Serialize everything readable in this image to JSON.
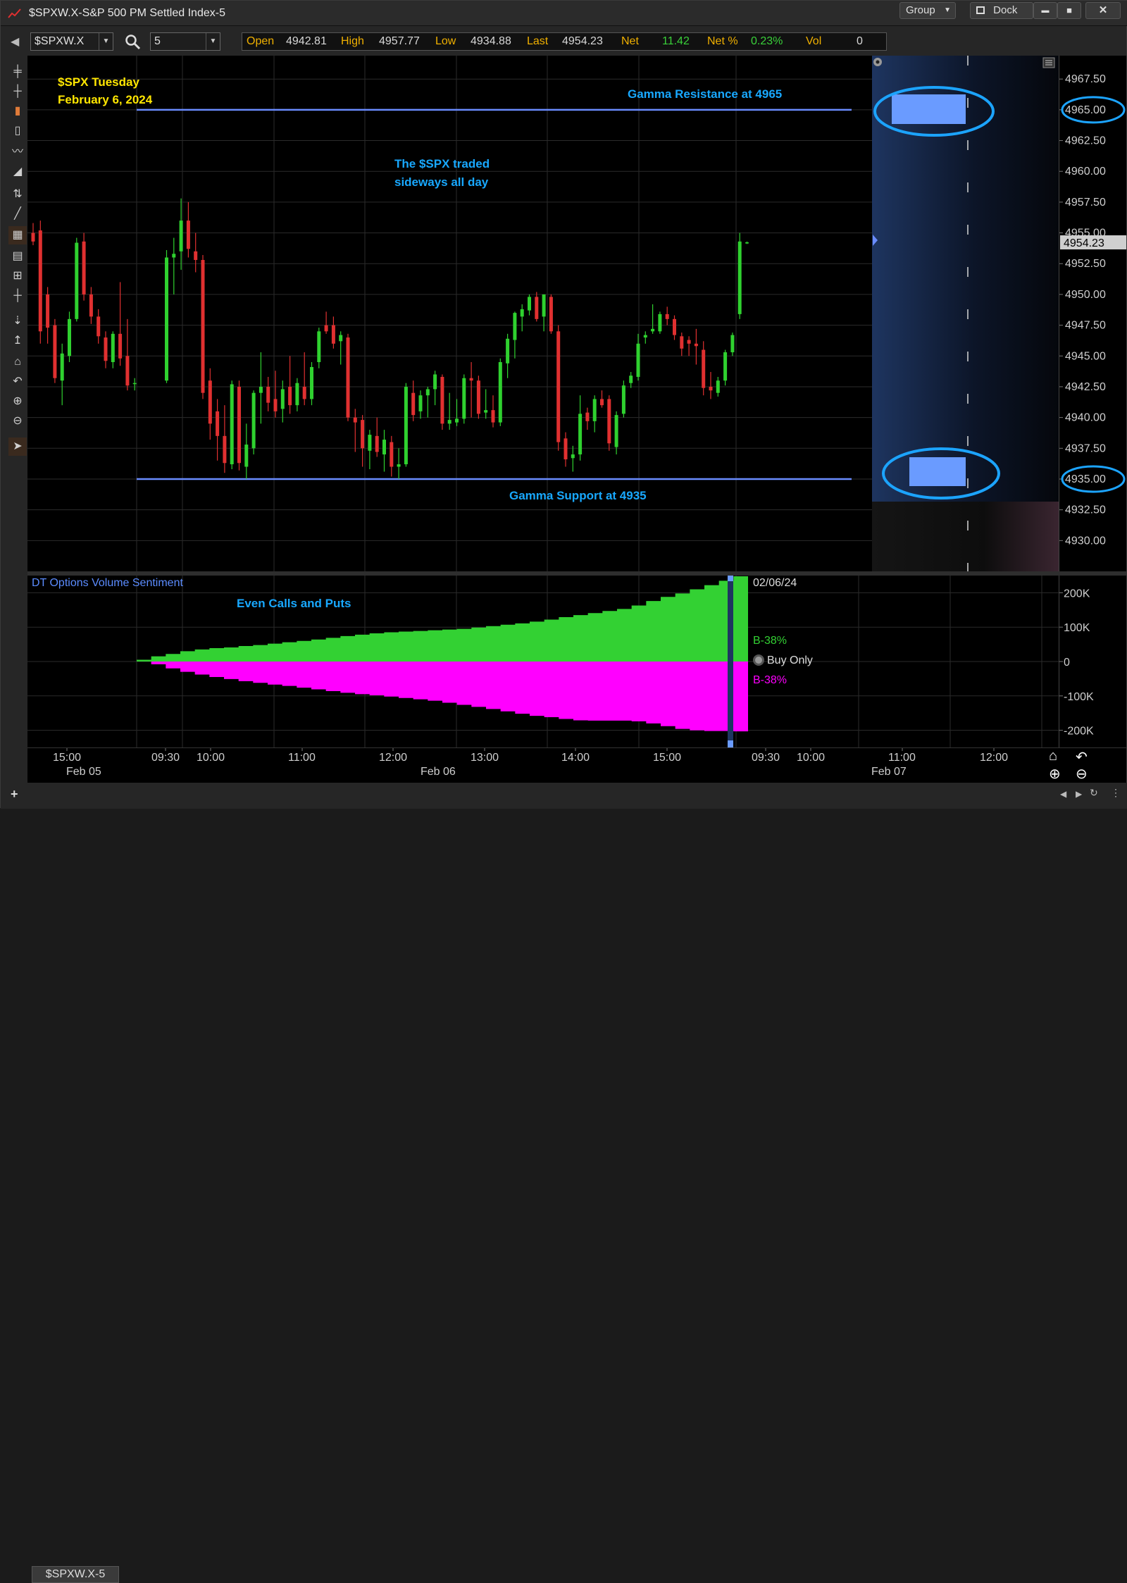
{
  "window": {
    "title": "$SPXW.X-S&P 500 PM Settled Index-5",
    "group_label": "Group",
    "dock_label": "Dock",
    "minimize": "▬",
    "maximize": "■",
    "close": "✕"
  },
  "toolbar": {
    "symbol": "$SPXW.X",
    "interval": "5"
  },
  "quote": {
    "open_label": "Open",
    "open": "4942.81",
    "high_label": "High",
    "high": "4957.77",
    "low_label": "Low",
    "low": "4934.88",
    "last_label": "Last",
    "last": "4954.23",
    "net_label": "Net",
    "net": "11.42",
    "netpct_label": "Net %",
    "netpct": "0.23%",
    "vol_label": "Vol",
    "vol": "0"
  },
  "annotations": {
    "date_line1": "$SPX Tuesday",
    "date_line2": "February 6, 2024",
    "resistance": "Gamma Resistance at 4965",
    "support": "Gamma Support at 4935",
    "comment_line1": "The $SPX traded",
    "comment_line2": "sideways all day",
    "volume_comment": "Even Calls and Puts"
  },
  "indicator": {
    "name": "DT Options Volume Sentiment",
    "date": "02/06/24",
    "buy_label_top": "B-38%",
    "buy_label_bottom": "B-38%",
    "mode": "Buy Only"
  },
  "colors": {
    "up": "#2fd12f",
    "down": "#e03030",
    "levels": "#6a8cff",
    "annotation_blue": "#18a8ff",
    "annotation_yellow": "#ffe600",
    "sentiment_pos": "#33d133",
    "sentiment_neg": "#ff00ff",
    "last_price_bg": "#cfcfcf"
  },
  "status": {
    "tab_label": "$SPXW.X-5",
    "add_tab": "+"
  },
  "chart_data": [
    {
      "type": "candlestick",
      "title": "$SPXW.X-S&P 500 PM Settled Index-5",
      "ylim": [
        4927.5,
        4969.4
      ],
      "yticks": [
        "4967.50",
        "4965.00",
        "4962.50",
        "4960.00",
        "4957.50",
        "4955.00",
        "4952.50",
        "4950.00",
        "4947.50",
        "4945.00",
        "4942.50",
        "4940.00",
        "4937.50",
        "4935.00",
        "4932.50",
        "4930.00"
      ],
      "last_price": "4954.23",
      "levels": [
        {
          "name": "Gamma Resistance",
          "value": 4965
        },
        {
          "name": "Gamma Support",
          "value": 4935
        }
      ],
      "grid": true,
      "candles": [
        {
          "o": 4955.0,
          "h": 4955.8,
          "l": 4954.0,
          "c": 4954.3
        },
        {
          "o": 4955.2,
          "h": 4956.0,
          "l": 4946.0,
          "c": 4947.0
        },
        {
          "o": 4950.0,
          "h": 4950.6,
          "l": 4946.0,
          "c": 4947.3
        },
        {
          "o": 4947.5,
          "h": 4948.0,
          "l": 4942.8,
          "c": 4943.2
        },
        {
          "o": 4943.0,
          "h": 4946.0,
          "l": 4941.0,
          "c": 4945.2
        },
        {
          "o": 4945.0,
          "h": 4948.6,
          "l": 4944.5,
          "c": 4948.0
        },
        {
          "o": 4948.0,
          "h": 4954.6,
          "l": 4947.8,
          "c": 4954.2
        },
        {
          "o": 4954.3,
          "h": 4955.0,
          "l": 4949.5,
          "c": 4950.0
        },
        {
          "o": 4950.0,
          "h": 4950.6,
          "l": 4947.6,
          "c": 4948.2
        },
        {
          "o": 4948.2,
          "h": 4948.8,
          "l": 4946.0,
          "c": 4946.6
        },
        {
          "o": 4946.5,
          "h": 4947.0,
          "l": 4944.0,
          "c": 4944.6
        },
        {
          "o": 4944.5,
          "h": 4947.0,
          "l": 4944.0,
          "c": 4946.8
        },
        {
          "o": 4946.8,
          "h": 4951.0,
          "l": 4944.2,
          "c": 4944.8
        },
        {
          "o": 4945.0,
          "h": 4948.0,
          "l": 4942.2,
          "c": 4942.6
        },
        {
          "o": 4942.8,
          "h": 4943.2,
          "l": 4942.2,
          "c": 4942.8
        },
        {
          "o": 4943.0,
          "h": 4953.6,
          "l": 4942.8,
          "c": 4953.0
        },
        {
          "o": 4953.0,
          "h": 4954.6,
          "l": 4950.0,
          "c": 4953.3
        },
        {
          "o": 4953.5,
          "h": 4957.8,
          "l": 4952.0,
          "c": 4956.0
        },
        {
          "o": 4956.0,
          "h": 4957.5,
          "l": 4953.0,
          "c": 4953.7
        },
        {
          "o": 4953.5,
          "h": 4955.0,
          "l": 4951.8,
          "c": 4952.8
        },
        {
          "o": 4952.8,
          "h": 4953.2,
          "l": 4941.5,
          "c": 4942.0
        },
        {
          "o": 4943.0,
          "h": 4944.0,
          "l": 4938.2,
          "c": 4939.5
        },
        {
          "o": 4940.5,
          "h": 4941.5,
          "l": 4936.5,
          "c": 4938.5
        },
        {
          "o": 4938.5,
          "h": 4941.0,
          "l": 4935.5,
          "c": 4936.3
        },
        {
          "o": 4936.2,
          "h": 4943.0,
          "l": 4935.8,
          "c": 4942.7
        },
        {
          "o": 4942.5,
          "h": 4943.0,
          "l": 4935.7,
          "c": 4936.3
        },
        {
          "o": 4936.0,
          "h": 4939.5,
          "l": 4935.0,
          "c": 4937.8
        },
        {
          "o": 4937.5,
          "h": 4942.2,
          "l": 4937.0,
          "c": 4942.0
        },
        {
          "o": 4942.0,
          "h": 4945.3,
          "l": 4939.5,
          "c": 4942.5
        },
        {
          "o": 4942.5,
          "h": 4943.3,
          "l": 4940.5,
          "c": 4941.2
        },
        {
          "o": 4941.5,
          "h": 4943.8,
          "l": 4940.0,
          "c": 4940.5
        },
        {
          "o": 4940.7,
          "h": 4943.0,
          "l": 4939.6,
          "c": 4942.3
        },
        {
          "o": 4942.5,
          "h": 4945.0,
          "l": 4940.3,
          "c": 4941.0
        },
        {
          "o": 4941.0,
          "h": 4943.2,
          "l": 4940.5,
          "c": 4942.8
        },
        {
          "o": 4942.5,
          "h": 4945.3,
          "l": 4941.0,
          "c": 4941.5
        },
        {
          "o": 4941.5,
          "h": 4944.5,
          "l": 4941.0,
          "c": 4944.1
        },
        {
          "o": 4944.5,
          "h": 4947.3,
          "l": 4944.0,
          "c": 4947.0
        },
        {
          "o": 4947.5,
          "h": 4948.6,
          "l": 4946.8,
          "c": 4947.0
        },
        {
          "o": 4947.5,
          "h": 4948.2,
          "l": 4945.6,
          "c": 4946.0
        },
        {
          "o": 4946.2,
          "h": 4947.0,
          "l": 4944.3,
          "c": 4946.7
        },
        {
          "o": 4946.5,
          "h": 4946.8,
          "l": 4939.7,
          "c": 4940.0
        },
        {
          "o": 4940.0,
          "h": 4940.7,
          "l": 4937.2,
          "c": 4939.6
        },
        {
          "o": 4939.8,
          "h": 4940.2,
          "l": 4936.0,
          "c": 4937.5
        },
        {
          "o": 4937.3,
          "h": 4939.0,
          "l": 4935.8,
          "c": 4938.6
        },
        {
          "o": 4938.5,
          "h": 4940.0,
          "l": 4936.8,
          "c": 4937.2
        },
        {
          "o": 4937.0,
          "h": 4939.0,
          "l": 4935.6,
          "c": 4938.2
        },
        {
          "o": 4938.0,
          "h": 4938.5,
          "l": 4935.2,
          "c": 4936.0
        },
        {
          "o": 4936.0,
          "h": 4937.5,
          "l": 4935.0,
          "c": 4936.2
        },
        {
          "o": 4936.2,
          "h": 4942.8,
          "l": 4936.0,
          "c": 4942.5
        },
        {
          "o": 4942.0,
          "h": 4943.0,
          "l": 4939.7,
          "c": 4940.2
        },
        {
          "o": 4940.5,
          "h": 4942.2,
          "l": 4939.9,
          "c": 4941.8
        },
        {
          "o": 4941.8,
          "h": 4942.5,
          "l": 4940.0,
          "c": 4942.3
        },
        {
          "o": 4942.3,
          "h": 4943.8,
          "l": 4941.0,
          "c": 4943.5
        },
        {
          "o": 4943.3,
          "h": 4943.5,
          "l": 4939.0,
          "c": 4939.5
        },
        {
          "o": 4939.5,
          "h": 4942.0,
          "l": 4939.0,
          "c": 4939.8
        },
        {
          "o": 4939.6,
          "h": 4941.5,
          "l": 4939.3,
          "c": 4939.9
        },
        {
          "o": 4939.9,
          "h": 4943.5,
          "l": 4939.5,
          "c": 4943.2
        },
        {
          "o": 4943.2,
          "h": 4944.5,
          "l": 4940.0,
          "c": 4943.0
        },
        {
          "o": 4943.0,
          "h": 4943.4,
          "l": 4939.9,
          "c": 4940.3
        },
        {
          "o": 4940.4,
          "h": 4942.3,
          "l": 4939.9,
          "c": 4940.6
        },
        {
          "o": 4940.6,
          "h": 4941.8,
          "l": 4939.2,
          "c": 4939.6
        },
        {
          "o": 4939.6,
          "h": 4944.8,
          "l": 4939.3,
          "c": 4944.5
        },
        {
          "o": 4944.4,
          "h": 4946.8,
          "l": 4943.2,
          "c": 4946.4
        },
        {
          "o": 4946.3,
          "h": 4948.6,
          "l": 4944.8,
          "c": 4948.5
        },
        {
          "o": 4948.2,
          "h": 4949.2,
          "l": 4947.0,
          "c": 4948.8
        },
        {
          "o": 4948.7,
          "h": 4950.0,
          "l": 4948.3,
          "c": 4949.8
        },
        {
          "o": 4949.8,
          "h": 4950.2,
          "l": 4947.8,
          "c": 4948.0
        },
        {
          "o": 4948.2,
          "h": 4950.0,
          "l": 4947.0,
          "c": 4950.0
        },
        {
          "o": 4949.8,
          "h": 4950.0,
          "l": 4946.8,
          "c": 4947.0
        },
        {
          "o": 4947.0,
          "h": 4947.5,
          "l": 4937.3,
          "c": 4938.0
        },
        {
          "o": 4938.3,
          "h": 4938.8,
          "l": 4936.0,
          "c": 4936.6
        },
        {
          "o": 4936.7,
          "h": 4937.7,
          "l": 4935.6,
          "c": 4937.0
        },
        {
          "o": 4937.0,
          "h": 4941.8,
          "l": 4936.5,
          "c": 4940.3
        },
        {
          "o": 4940.4,
          "h": 4940.8,
          "l": 4939.0,
          "c": 4939.7
        },
        {
          "o": 4939.7,
          "h": 4941.8,
          "l": 4938.8,
          "c": 4941.5
        },
        {
          "o": 4941.5,
          "h": 4942.2,
          "l": 4940.8,
          "c": 4941.0
        },
        {
          "o": 4941.5,
          "h": 4941.8,
          "l": 4937.3,
          "c": 4937.9
        },
        {
          "o": 4937.6,
          "h": 4940.5,
          "l": 4937.0,
          "c": 4940.2
        },
        {
          "o": 4940.3,
          "h": 4943.0,
          "l": 4940.0,
          "c": 4942.6
        },
        {
          "o": 4942.8,
          "h": 4943.7,
          "l": 4942.4,
          "c": 4943.4
        },
        {
          "o": 4943.3,
          "h": 4946.8,
          "l": 4943.0,
          "c": 4946.0
        },
        {
          "o": 4946.5,
          "h": 4947.0,
          "l": 4946.0,
          "c": 4946.7
        },
        {
          "o": 4947.0,
          "h": 4949.2,
          "l": 4946.8,
          "c": 4947.2
        },
        {
          "o": 4947.0,
          "h": 4948.6,
          "l": 4946.8,
          "c": 4948.4
        },
        {
          "o": 4948.4,
          "h": 4949.0,
          "l": 4947.5,
          "c": 4948.0
        },
        {
          "o": 4948.0,
          "h": 4948.3,
          "l": 4946.3,
          "c": 4946.7
        },
        {
          "o": 4946.6,
          "h": 4946.9,
          "l": 4945.0,
          "c": 4945.6
        },
        {
          "o": 4946.3,
          "h": 4946.6,
          "l": 4945.0,
          "c": 4946.0
        },
        {
          "o": 4946.0,
          "h": 4947.2,
          "l": 4944.3,
          "c": 4945.8
        },
        {
          "o": 4945.5,
          "h": 4946.2,
          "l": 4941.8,
          "c": 4942.4
        },
        {
          "o": 4942.5,
          "h": 4943.7,
          "l": 4941.5,
          "c": 4942.2
        },
        {
          "o": 4942.0,
          "h": 4943.3,
          "l": 4941.7,
          "c": 4943.0
        },
        {
          "o": 4943.0,
          "h": 4945.5,
          "l": 4942.6,
          "c": 4945.3
        },
        {
          "o": 4945.3,
          "h": 4946.9,
          "l": 4945.0,
          "c": 4946.7
        },
        {
          "o": 4948.4,
          "h": 4955.0,
          "l": 4948.0,
          "c": 4954.3
        },
        {
          "o": 4954.2,
          "h": 4954.3,
          "l": 4954.1,
          "c": 4954.23
        }
      ]
    },
    {
      "type": "area",
      "title": "DT Options Volume Sentiment",
      "ylim": [
        -250000,
        250000
      ],
      "yticks": [
        "200K",
        "100K",
        "0",
        "-100K",
        "-200K"
      ],
      "series": [
        {
          "name": "Calls",
          "values": [
            5000,
            15000,
            22000,
            30000,
            35000,
            39000,
            41000,
            45000,
            48000,
            52000,
            56000,
            60000,
            64000,
            69000,
            74000,
            78000,
            82000,
            85000,
            87000,
            89000,
            91000,
            93000,
            95000,
            99000,
            103000,
            107000,
            111000,
            116000,
            122000,
            129000,
            135000,
            141000,
            147000,
            153000,
            163000,
            176000,
            188000,
            198000,
            210000,
            222000,
            235000,
            248000
          ]
        },
        {
          "name": "Puts",
          "values": [
            0,
            -8000,
            -20000,
            -30000,
            -38000,
            -45000,
            -51000,
            -57000,
            -62000,
            -67000,
            -71000,
            -76000,
            -81000,
            -86000,
            -91000,
            -95000,
            -98000,
            -102000,
            -106000,
            -110000,
            -114000,
            -120000,
            -126000,
            -132000,
            -138000,
            -145000,
            -152000,
            -158000,
            -162000,
            -167000,
            -171000,
            -172000,
            -172000,
            -172000,
            -174000,
            -180000,
            -188000,
            -196000,
            -200000,
            -202000,
            -202000,
            -203000
          ]
        }
      ]
    }
  ],
  "axes": {
    "time_top": [
      "15:00",
      "09:30",
      "10:00",
      "11:00",
      "12:00",
      "13:00",
      "14:00",
      "15:00",
      "09:30",
      "10:00",
      "11:00",
      "12:00"
    ],
    "time_dates": [
      "Feb 05",
      "Feb 06",
      "Feb 07"
    ]
  }
}
